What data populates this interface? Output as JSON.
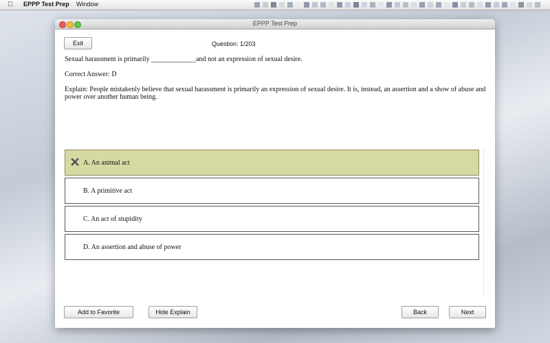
{
  "menubar": {
    "app_name": "EPPP Test Prep",
    "menu_window": "Window"
  },
  "window": {
    "title": "EPPP Test Prep"
  },
  "toolbar": {
    "exit_label": "Exit"
  },
  "question": {
    "counter": "Question:  1/203",
    "text": "Sexual harassment is primarily _____________and not an expression of sexual desire.",
    "correct_answer": "Correct Answer: D",
    "explanation": "Explain: People mistakenly believe that sexual harassment is primarily an expression of sexual desire. It is, instead, an assertion and a show of abuse and power over another human being."
  },
  "options": [
    {
      "label": "A. An animal act",
      "state": "wrong",
      "icon": "x-mark-icon"
    },
    {
      "label": "B. A primitive act",
      "state": "none"
    },
    {
      "label": "C. An act of stupidity",
      "state": "none"
    },
    {
      "label": "D. An assertion and abuse of power",
      "state": "none"
    }
  ],
  "footer": {
    "add_favorite_label": "Add to Favorite",
    "hide_explain_label": "Hide Explain",
    "back_label": "Back",
    "next_label": "Next"
  },
  "colors": {
    "wrong_answer_bg": "#d7d9a3",
    "window_bg": "#ffffff"
  }
}
